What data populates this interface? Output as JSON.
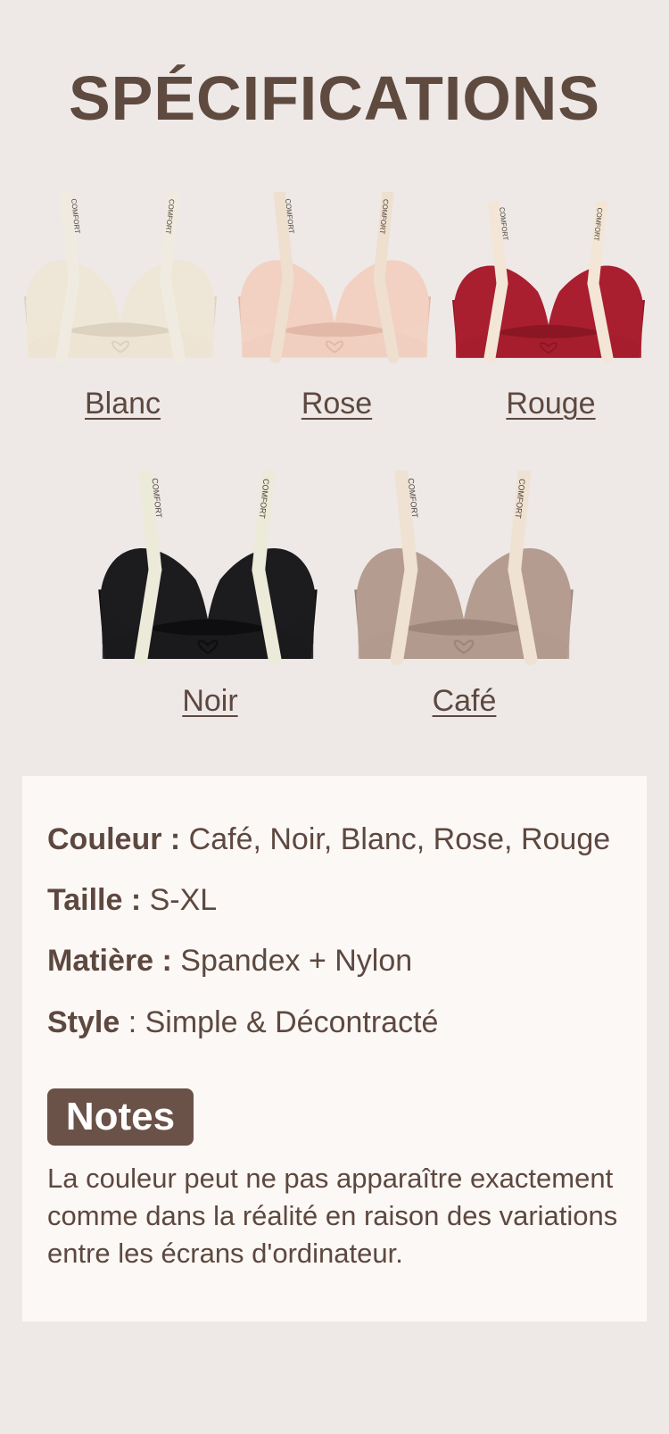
{
  "title": "SPÉCIFICATIONS",
  "products": [
    {
      "color_name": "Blanc",
      "fabric": "#eee6d6",
      "shade": "#ddd2bf",
      "strap": "#f0ebe0",
      "strap_text": "COMFORT"
    },
    {
      "color_name": "Rose",
      "fabric": "#f2d1c2",
      "shade": "#e2b9a8",
      "strap": "#eedfcf",
      "strap_text": "COMFORT"
    },
    {
      "color_name": "Rouge",
      "fabric": "#a91f30",
      "shade": "#8c1724",
      "strap": "#f3e6d6",
      "strap_text": "COMFORT"
    },
    {
      "color_name": "Noir",
      "fabric": "#1c1c1e",
      "shade": "#0e0e10",
      "strap": "#ecead9",
      "strap_text": "COMFORT"
    },
    {
      "color_name": "Café",
      "fabric": "#b59c90",
      "shade": "#9e867a",
      "strap": "#efe2d2",
      "strap_text": "COMFORT"
    }
  ],
  "specs": {
    "color": {
      "label": "Couleur :",
      "value": "Café, Noir, Blanc, Rose, Rouge"
    },
    "size": {
      "label": "Taille :",
      "value": "S-XL"
    },
    "material": {
      "label": "Matière :",
      "value": "Spandex + Nylon"
    },
    "style": {
      "label": "Style",
      "sep": " : ",
      "value": "Simple & Décontracté"
    }
  },
  "notes": {
    "badge": "Notes",
    "text": "La couleur peut ne pas apparaître exactement comme dans la réalité en raison des variations entre les écrans d'ordinateur."
  }
}
